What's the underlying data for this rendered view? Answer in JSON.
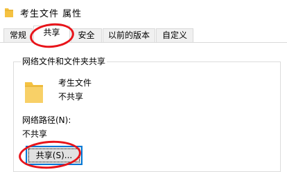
{
  "window": {
    "title": "考生文件 属性"
  },
  "tabs": [
    {
      "label": "常规"
    },
    {
      "label": "共享"
    },
    {
      "label": "安全"
    },
    {
      "label": "以前的版本"
    },
    {
      "label": "自定义"
    }
  ],
  "active_tab": "共享",
  "share_group": {
    "title": "网络文件和文件夹共享",
    "folder_name": "考生文件",
    "folder_status": "不共享",
    "network_path_label": "网络路径(N):",
    "network_path_value": "不共享",
    "share_button_label": "共享(S)..."
  },
  "icons": {
    "title_icon": "folder-icon",
    "folder_icon": "folder-icon"
  },
  "colors": {
    "annotation": "#e8141a",
    "button_focus": "#0078d7",
    "folder": "#f5c242"
  }
}
